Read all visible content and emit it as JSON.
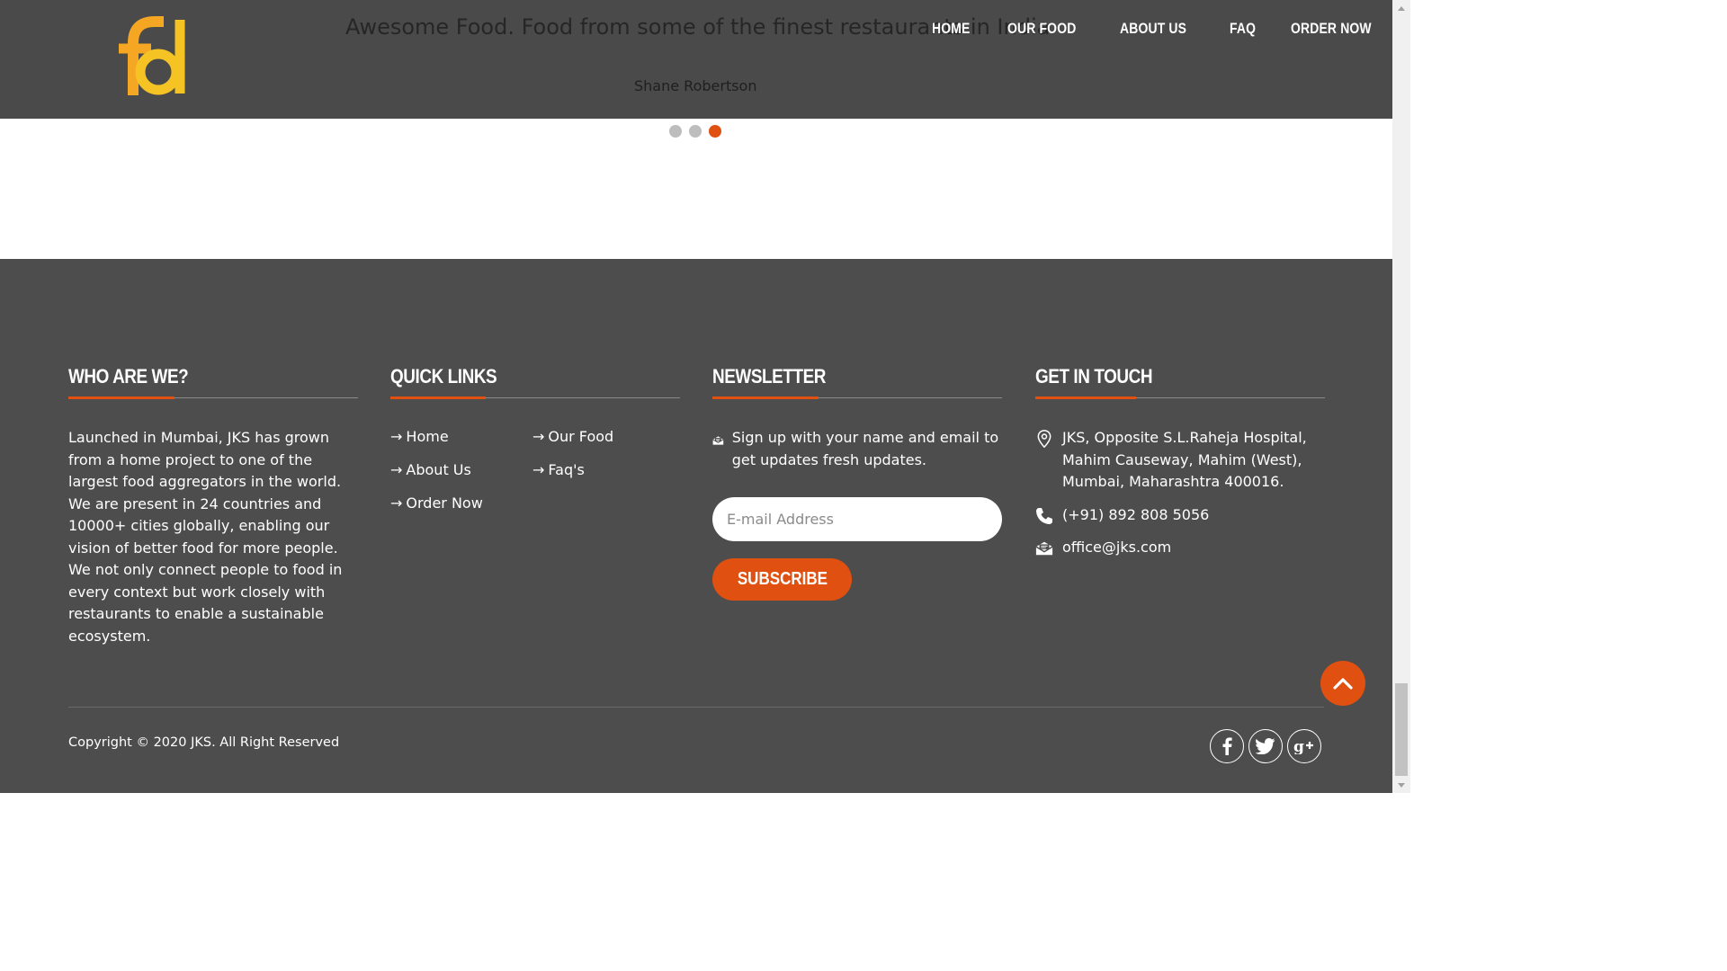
{
  "header": {
    "logo_text": "fd",
    "testimonial_quote": "Awesome Food. Food from some of the finest restaurants in India",
    "testimonial_author": "Shane Robertson",
    "nav": [
      "HOME",
      "OUR FOOD",
      "ABOUT US",
      "FAQ",
      "ORDER NOW"
    ]
  },
  "carousel": {
    "slides": 3,
    "active": 3
  },
  "footer": {
    "who": {
      "title": "WHO ARE WE?",
      "text": "Launched in Mumbai, JKS has grown from a home project to one of the largest food aggregators in the world. We are present in 24 countries and 10000+ cities globally, enabling our vision of better food for more people. We not only connect people to food in every context but work closely with restaurants to enable a sustainable ecosystem."
    },
    "links": {
      "title": "QUICK LINKS",
      "arrow": "→",
      "items": [
        "Home",
        "Our Food",
        "About Us",
        "Faq's",
        "Order Now"
      ]
    },
    "newsletter": {
      "title": "NEWSLETTER",
      "intro": "Sign up with your name and email to get updates fresh updates.",
      "email_placeholder": "E-mail Address",
      "subscribe_label": "SUBSCRIBE"
    },
    "touch": {
      "title": "GET IN TOUCH",
      "address": "JKS, Opposite S.L.Raheja Hospital, Mahim Causeway, Mahim (West), Mumbai, Maharashtra 400016.",
      "phone": "(+91) 892 808 5056",
      "email": "office@jks.com"
    },
    "copyright": "Copyright © 2020 JKS. All Right Reserved"
  },
  "icons": {
    "socials": [
      "facebook-icon",
      "twitter-icon",
      "google-plus-icon"
    ],
    "back_to_top": "chevron-up-icon"
  },
  "colors": {
    "accent": "#e05010",
    "logo": "#f5a623",
    "dark_bg": "#4a4a4a",
    "footer_bg": "#4d4d4d"
  }
}
